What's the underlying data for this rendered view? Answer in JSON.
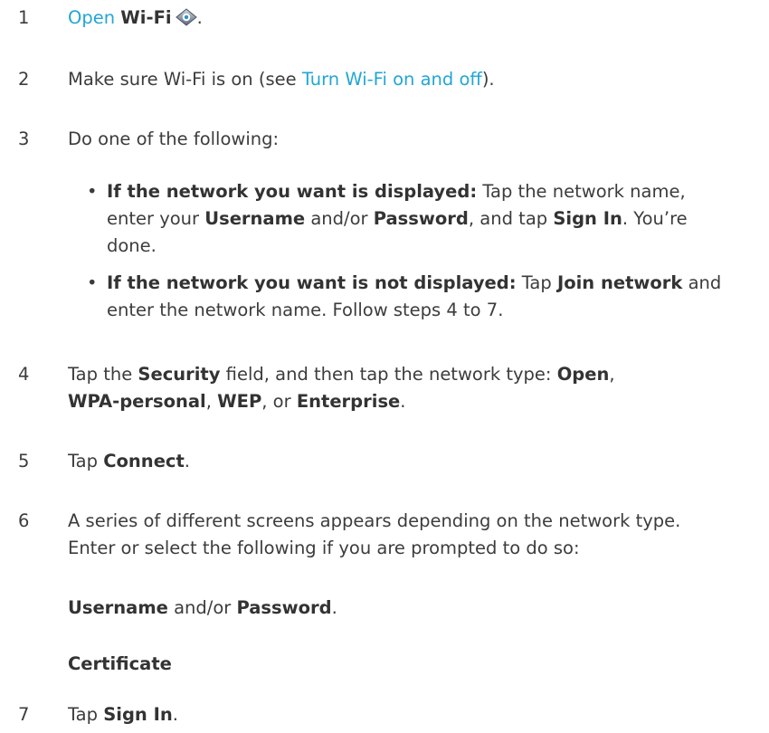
{
  "steps": {
    "s1": {
      "num": "1",
      "link": "Open",
      "bold": "Wi-Fi",
      "icon": "wifi-app-icon",
      "end": "."
    },
    "s2": {
      "num": "2",
      "pre": "Make sure Wi-Fi is on (see ",
      "link": "Turn Wi-Fi on and off",
      "post": ")."
    },
    "s3": {
      "num": "3",
      "text": "Do one of the following:",
      "bullet1": {
        "lead": "If the network you want is displayed:",
        "t1": " Tap the network name,",
        "t2": "enter your ",
        "b1": "Username",
        "t3": " and/or ",
        "b2": "Password",
        "t4": ", and tap ",
        "b3": "Sign In",
        "t5": ". You’re",
        "t6": "done."
      },
      "bullet2": {
        "lead": "If the network you want is not displayed:",
        "t1": " Tap ",
        "b1": "Join network",
        "t2": " and",
        "t3": "enter the network name. Follow steps 4 to 7."
      }
    },
    "s4": {
      "num": "4",
      "t1": "Tap the ",
      "b1": "Security",
      "t2": " field, and then tap the network type: ",
      "b2": "Open",
      "t3": ",",
      "b3": "WPA-personal",
      "t4": ", ",
      "b4": "WEP",
      "t5": ", or ",
      "b5": "Enterprise",
      "t6": "."
    },
    "s5": {
      "num": "5",
      "t1": "Tap ",
      "b1": "Connect",
      "t2": "."
    },
    "s6": {
      "num": "6",
      "line1": "A series of different screens appears depending on the network type.",
      "line2": "Enter or select the following if you are prompted to do so:",
      "b1": "Username",
      "t1": " and/or ",
      "b2": "Password",
      "t2": ".",
      "b3": "Certificate"
    },
    "s7": {
      "num": "7",
      "t1": "Tap ",
      "b1": "Sign In",
      "t2": "."
    }
  },
  "colors": {
    "link": "#22a6d6",
    "text": "#3c3c3c"
  }
}
